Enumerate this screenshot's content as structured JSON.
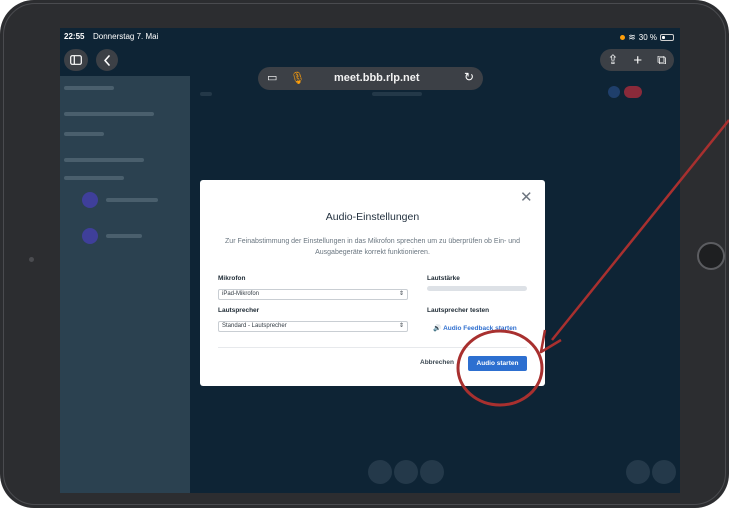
{
  "status_bar": {
    "time": "22:55",
    "date": "Donnerstag 7. Mai",
    "battery": "30 %",
    "battery_level": 0.3,
    "wifi_icon": "wifi-icon"
  },
  "browser": {
    "url": "meet.bbb.rlp.net",
    "icons": [
      "sidebar-icon",
      "back-icon",
      "page-settings-icon",
      "microphone-icon",
      "reload-icon",
      "share-icon",
      "new-tab-icon",
      "tabs-icon"
    ]
  },
  "dialog": {
    "title": "Audio-Einstellungen",
    "description": "Zur Feinabstimmung der Einstellungen in das Mikrofon sprechen um zu überprüfen ob Ein- und Ausgabegeräte korrekt funktionieren.",
    "microphone_label": "Mikrofon",
    "microphone_value": "iPad-Mikrofon",
    "speaker_label": "Lautsprecher",
    "speaker_value": "Standard - Lautsprecher",
    "volume_label": "Lautstärke",
    "volume_level": 0.0,
    "test_speaker_label": "Lautsprecher testen",
    "feedback_link": "Audio Feedback starten",
    "cancel_label": "Abbrechen",
    "start_label": "Audio starten"
  },
  "colors": {
    "accent": "#2d6fd0",
    "annotation": "#a8302f",
    "background": "#0e2435"
  }
}
